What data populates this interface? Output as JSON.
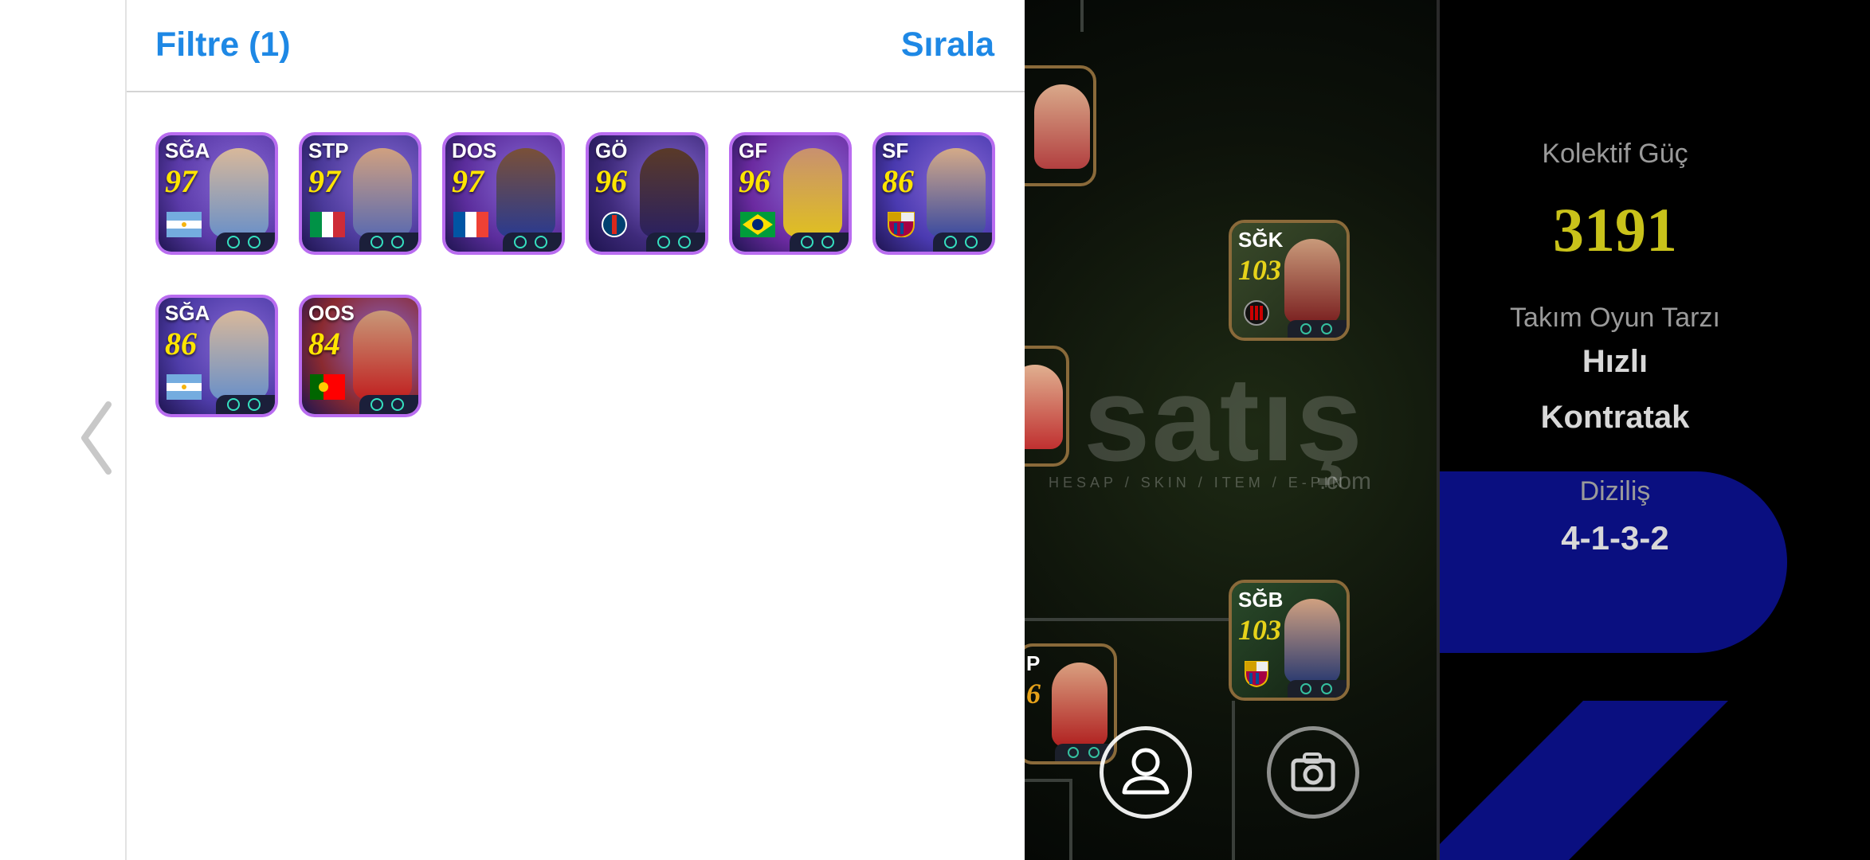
{
  "header": {
    "filter_label": "Filtre (1)",
    "sort_label": "Sırala"
  },
  "players": [
    {
      "position": "SĞA",
      "rating": "97",
      "badge": "flag-argentina",
      "bg": "#5a3aa8"
    },
    {
      "position": "STP",
      "rating": "97",
      "badge": "flag-italy",
      "bg": "#4b3a9a"
    },
    {
      "position": "DOS",
      "rating": "97",
      "badge": "flag-france",
      "bg": "#5b2d9c"
    },
    {
      "position": "GÖ",
      "rating": "96",
      "badge": "club-psg",
      "bg": "#3e2a7a"
    },
    {
      "position": "GF",
      "rating": "96",
      "badge": "flag-brazil",
      "bg": "#6b2aa0"
    },
    {
      "position": "SF",
      "rating": "86",
      "badge": "club-barcelona",
      "bg": "#4a3ab0"
    },
    {
      "position": "SĞA",
      "rating": "86",
      "badge": "flag-argentina",
      "bg": "#4e3ca8"
    },
    {
      "position": "OOS",
      "rating": "84",
      "badge": "flag-portugal",
      "bg": "#8a2a30"
    }
  ],
  "pitch": {
    "cards": [
      {
        "position": "SĞK",
        "rating": "103",
        "badge": "club-milan"
      },
      {
        "position": "SĞB",
        "rating": "103",
        "badge": "club-barcelona"
      },
      {
        "position": "P",
        "rating": "6",
        "badge": "club-manutd"
      }
    ],
    "watermark": "satış",
    "watermark_sub": "HESAP / SKIN / ITEM / E-PIN",
    "watermark_com": ".com"
  },
  "team_info": {
    "power_label": "Kolektif Güç",
    "power_value": "3191",
    "style_label": "Takım Oyun Tarzı",
    "style_value_line1": "Hızlı",
    "style_value_line2": "Kontratak",
    "formation_label": "Diziliş",
    "formation_value": "4-1-3-2"
  },
  "colors": {
    "accent": "#1e88e5",
    "power": "#c9c21a",
    "formation_bg": "#0a0f80"
  }
}
